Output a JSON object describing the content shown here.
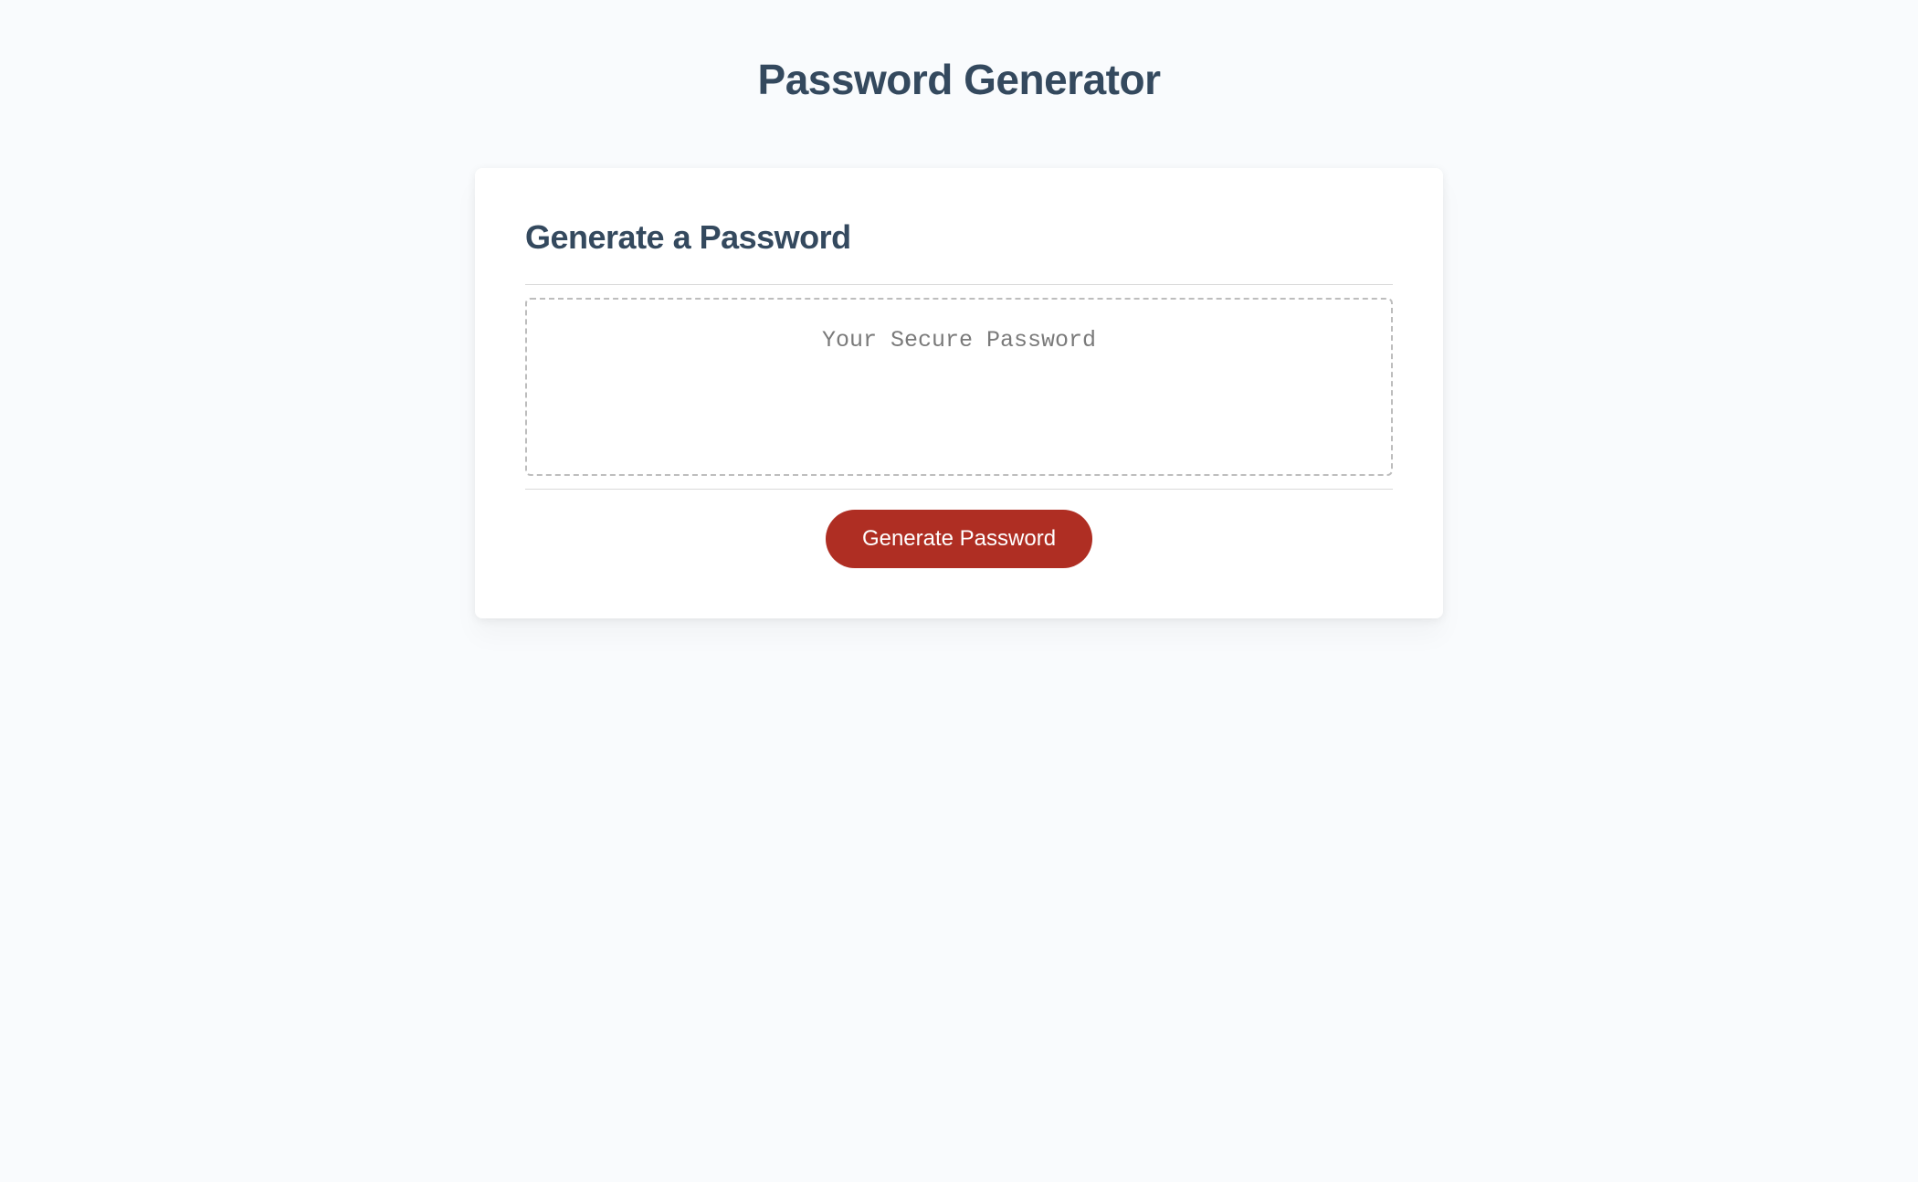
{
  "header": {
    "title": "Password Generator"
  },
  "card": {
    "heading": "Generate a Password",
    "password_placeholder": "Your Secure Password",
    "generate_button_label": "Generate Password"
  }
}
